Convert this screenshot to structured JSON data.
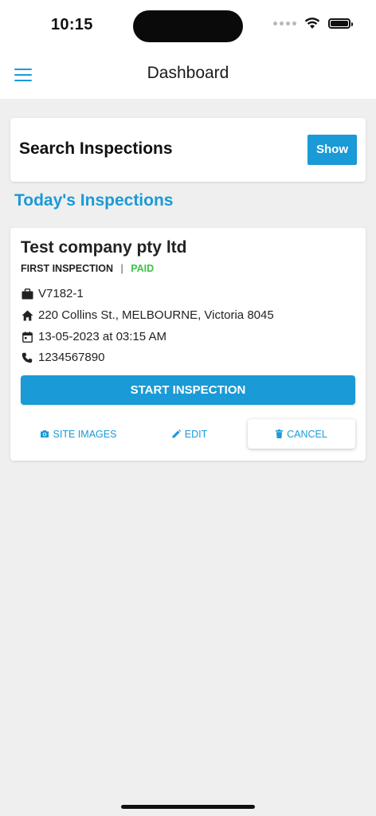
{
  "status_bar": {
    "time": "10:15"
  },
  "app_bar": {
    "title": "Dashboard",
    "menu_icon": "hamburger-menu-icon"
  },
  "search_card": {
    "title": "Search Inspections",
    "button": "Show"
  },
  "section": {
    "title": "Today's Inspections"
  },
  "inspection": {
    "company": "Test company pty ltd",
    "type": "FIRST INSPECTION",
    "separator": "|",
    "status": "PAID",
    "reference": "V7182-1",
    "address": "220 Collins St., MELBOURNE, Victoria 8045",
    "datetime": "13-05-2023 at 03:15 AM",
    "phone": "1234567890",
    "start_button": "START INSPECTION",
    "actions": {
      "site_images": "SITE IMAGES",
      "edit": "EDIT",
      "cancel": "CANCEL"
    }
  },
  "colors": {
    "accent": "#1a9ad6",
    "paid": "#3cc24a",
    "background": "#efefef"
  }
}
